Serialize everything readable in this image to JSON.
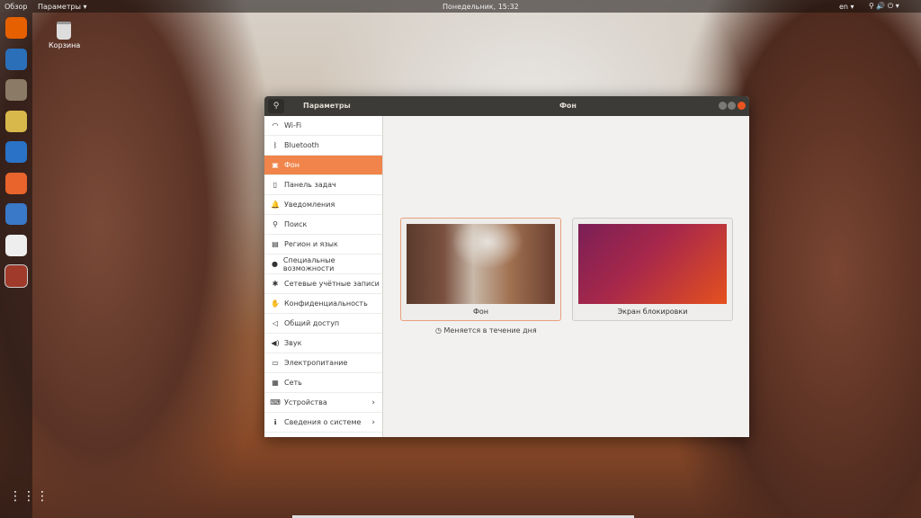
{
  "topbar": {
    "activities": "Обзор",
    "app_menu": "Параметры ▾",
    "clock": "Понедельник, 15:32",
    "lang": "en ▾",
    "tray": "⚲ 🔊 ⏻ ▾"
  },
  "desktop": {
    "trash_label": "Корзина"
  },
  "dock": [
    {
      "icon": "firefox-icon",
      "color": "#e66000"
    },
    {
      "icon": "thunderbird-icon",
      "color": "#2a6fb8"
    },
    {
      "icon": "files-icon",
      "color": "#8a7a66"
    },
    {
      "icon": "rhythmbox-icon",
      "color": "#d8b84a"
    },
    {
      "icon": "writer-icon",
      "color": "#2a72c8"
    },
    {
      "icon": "software-icon",
      "color": "#e8642c"
    },
    {
      "icon": "help-icon",
      "color": "#3a78c8"
    },
    {
      "icon": "amazon-icon",
      "color": "#eeeeee"
    },
    {
      "icon": "settings-icon",
      "color": "#a03a2a"
    }
  ],
  "window": {
    "sidebar_title": "Параметры",
    "title": "Фон",
    "sidebar": [
      {
        "icon": "wifi-icon",
        "glyph": "◠",
        "label": "Wi-Fi"
      },
      {
        "icon": "bluetooth-icon",
        "glyph": "ᛒ",
        "label": "Bluetooth"
      },
      {
        "icon": "background-icon",
        "glyph": "▣",
        "label": "Фон"
      },
      {
        "icon": "dock-icon",
        "glyph": "▯",
        "label": "Панель задач"
      },
      {
        "icon": "bell-icon",
        "glyph": "🔔",
        "label": "Уведомления"
      },
      {
        "icon": "search-icon",
        "glyph": "⚲",
        "label": "Поиск"
      },
      {
        "icon": "region-icon",
        "glyph": "▤",
        "label": "Регион и язык"
      },
      {
        "icon": "accessibility-icon",
        "glyph": "●",
        "label": "Специальные возможности"
      },
      {
        "icon": "online-accounts-icon",
        "glyph": "✱",
        "label": "Сетевые учётные записи"
      },
      {
        "icon": "privacy-icon",
        "glyph": "✋",
        "label": "Конфиденциальность"
      },
      {
        "icon": "share-icon",
        "glyph": "◁",
        "label": "Общий доступ"
      },
      {
        "icon": "sound-icon",
        "glyph": "◀)",
        "label": "Звук"
      },
      {
        "icon": "power-icon",
        "glyph": "▭",
        "label": "Электропитание"
      },
      {
        "icon": "network-icon",
        "glyph": "▦",
        "label": "Сеть"
      },
      {
        "icon": "devices-icon",
        "glyph": "⌨",
        "label": "Устройства",
        "chevron": "›"
      },
      {
        "icon": "info-icon",
        "glyph": "ℹ",
        "label": "Сведения о системе",
        "chevron": "›"
      }
    ],
    "background_label": "Фон",
    "lock_label": "Экран блокировки",
    "note": "Меняется в течение дня",
    "note_icon": "◷"
  }
}
